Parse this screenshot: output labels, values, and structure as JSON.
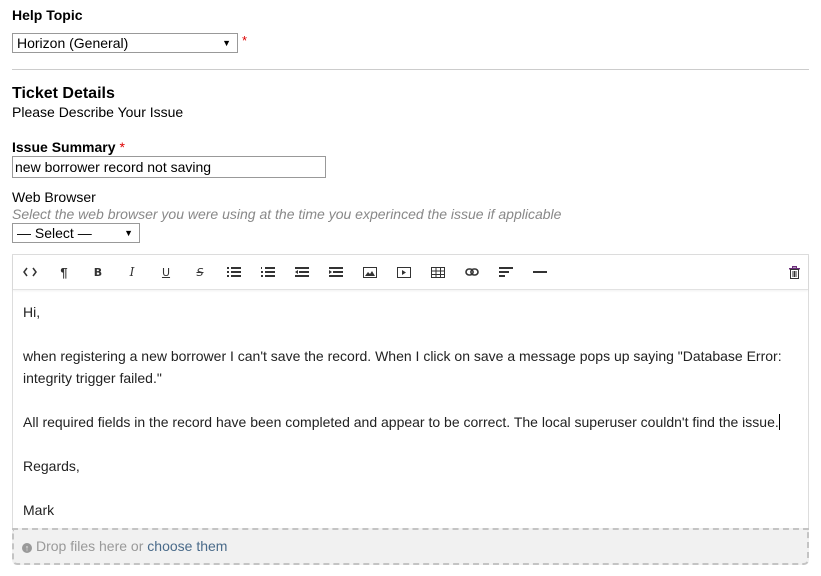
{
  "help_topic": {
    "label": "Help Topic",
    "selected": "Horizon (General)",
    "required_mark": "*"
  },
  "ticket_details": {
    "title": "Ticket Details",
    "subtitle": "Please Describe Your Issue"
  },
  "issue_summary": {
    "label": "Issue Summary",
    "required_mark": "*",
    "value": "new borrower record not saving"
  },
  "web_browser": {
    "label": "Web Browser",
    "hint": "Select the web browser you were using at the time you experinced the issue if applicable",
    "selected": "— Select —"
  },
  "toolbar": {
    "buttons": [
      {
        "name": "html",
        "icon": "code-icon",
        "glyph": "<>"
      },
      {
        "name": "formatting",
        "icon": "paragraph-icon",
        "glyph": "¶"
      },
      {
        "name": "bold",
        "icon": "bold-icon",
        "glyph": "B"
      },
      {
        "name": "italic",
        "icon": "italic-icon",
        "glyph": "I"
      },
      {
        "name": "underline",
        "icon": "underline-icon",
        "glyph": "U"
      },
      {
        "name": "strikethrough",
        "icon": "strikethrough-icon",
        "glyph": "S"
      },
      {
        "name": "unordered-list",
        "icon": "bullet-list-icon"
      },
      {
        "name": "ordered-list",
        "icon": "numbered-list-icon"
      },
      {
        "name": "outdent",
        "icon": "outdent-icon"
      },
      {
        "name": "indent",
        "icon": "indent-icon"
      },
      {
        "name": "image",
        "icon": "image-icon"
      },
      {
        "name": "video",
        "icon": "video-icon"
      },
      {
        "name": "table",
        "icon": "table-icon"
      },
      {
        "name": "link",
        "icon": "link-icon"
      },
      {
        "name": "alignment",
        "icon": "align-left-icon"
      },
      {
        "name": "horizontal-rule",
        "icon": "horizontal-rule-icon"
      }
    ],
    "delete_icon": "trash-icon",
    "delete_color": "#6b2c7a"
  },
  "message": {
    "paragraphs": [
      "Hi,",
      "when registering a new borrower I can't save the record. When I click on save a message pops up saying \"Database Error: integrity trigger failed.\"",
      "All required fields in the record have been completed and appear to be correct.  The local superuser couldn't find the issue.",
      "Regards,",
      "Mark"
    ]
  },
  "dropzone": {
    "text": "Drop files here or",
    "link": "choose them"
  }
}
